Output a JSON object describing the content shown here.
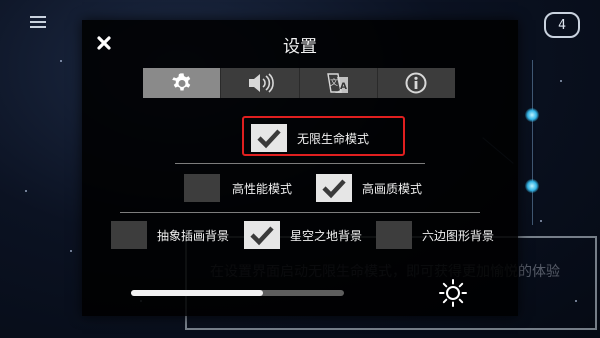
{
  "dialog": {
    "title": "设置"
  },
  "tabs": [
    {
      "icon": "gear-icon",
      "active": true
    },
    {
      "icon": "speaker-icon",
      "active": false
    },
    {
      "icon": "language-icon",
      "active": false
    },
    {
      "icon": "info-icon",
      "active": false
    }
  ],
  "options": {
    "infinite_life": {
      "label": "无限生命模式",
      "checked": true
    },
    "high_performance": {
      "label": "高性能模式",
      "checked": false
    },
    "high_quality": {
      "label": "高画质模式",
      "checked": true
    },
    "abstract_bg": {
      "label": "抽象插画背景",
      "checked": false
    },
    "starfield_bg": {
      "label": "星空之地背景",
      "checked": true
    },
    "hexagon_bg": {
      "label": "六边图形背景",
      "checked": false
    }
  },
  "brightness": {
    "value": 0.62
  },
  "hud": {
    "lives": "4"
  },
  "hint": {
    "text": "在设置界面启动无限生命模式，即可获得更加愉悦的体验"
  },
  "colors": {
    "highlight": "#e01f1f",
    "checkbox_on": "#e6e6e6",
    "checkbox_off": "#3d3d3d"
  }
}
